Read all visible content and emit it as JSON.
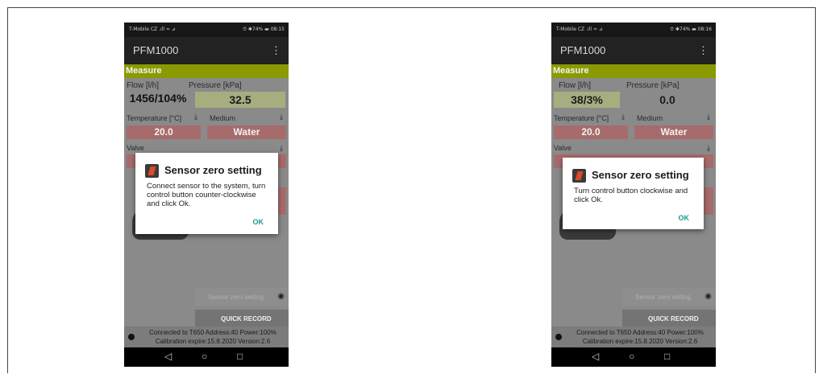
{
  "phones": [
    {
      "status": {
        "carrier": "T-Mobile CZ .ıll ≈ ⊿",
        "right": "⏱ ✱74% ▬ 08:15"
      },
      "app_title": "PFM1000",
      "section": "Measure",
      "flow_label": "Flow [l/h]",
      "flow_value": "1456/104%",
      "pressure_label": "Pressure [kPa]",
      "pressure_value": "32.5",
      "temperature_label": "Temperature [°C]",
      "temperature_value": "20.0",
      "medium_label": "Medium",
      "medium_value": "Water",
      "valve_label": "Valve",
      "sensor_button": "Sensor zero setting",
      "quick_record": "QUICK RECORD",
      "info_line1": "Connected to T650 Address:40 Power:100%",
      "info_line2": "Calibration expire:15.8.2020 Version:2.6",
      "dialog": {
        "title": "Sensor zero setting",
        "message": "Connect sensor to the system, turn control button counter-clockwise and click Ok.",
        "ok": "OK"
      }
    },
    {
      "status": {
        "carrier": "T-Mobile CZ .ıll ≈ ⊿",
        "right": "⏱ ✱74% ▬ 08:16"
      },
      "app_title": "PFM1000",
      "section": "Measure",
      "flow_label": "Flow [l/h]",
      "flow_value": "38/3%",
      "pressure_label": "Pressure [kPa]",
      "pressure_value": "0.0",
      "temperature_label": "Temperature [°C]",
      "temperature_value": "20.0",
      "medium_label": "Medium",
      "medium_value": "Water",
      "valve_label": "Valve",
      "sensor_button": "Sensor zero setting",
      "quick_record": "QUICK RECORD",
      "info_line1": "Connected to T650 Address:40 Power:100%",
      "info_line2": "Calibration expire:15.8.2020 Version:2.6",
      "dialog": {
        "title": "Sensor zero setting",
        "message": "Turn control button clockwise and click Ok.",
        "ok": "OK"
      }
    }
  ],
  "icons": {
    "download": "⤓",
    "menu": "⋮",
    "radio": "◉",
    "back": "◁",
    "home": "○",
    "recent": "□"
  }
}
